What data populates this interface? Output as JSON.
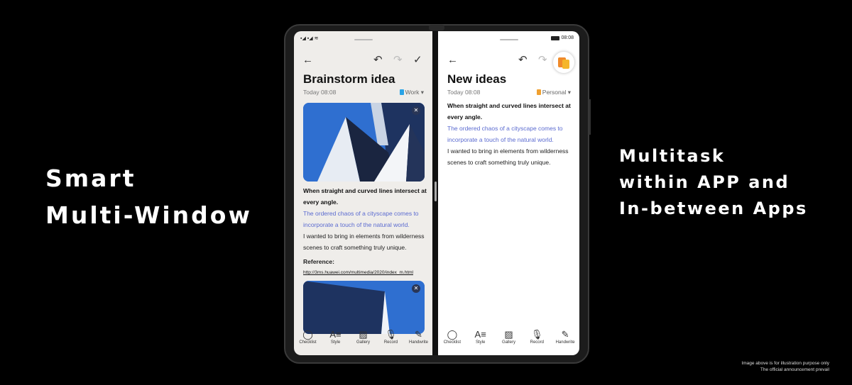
{
  "headlines": {
    "left": [
      "Smart",
      "Multi-Window"
    ],
    "right": [
      "Multitask",
      "within APP and",
      "In-between Apps"
    ]
  },
  "disclaimer": [
    "Image above is for illustration purpose only",
    "The official announcement prevail"
  ],
  "left_app": {
    "status_icons": "signal-signal-wifi",
    "title": "Brainstorm idea",
    "date": "Today 08:08",
    "category": "Work",
    "category_color": "#29a3e6",
    "paragraph_bold": "When straight and curved lines intersect at every angle.",
    "paragraph_blue": "The ordered chaos of a cityscape comes to incorporate a touch of the natural world.",
    "paragraph_normal": "I wanted to bring in elements from wilderness scenes to craft something truly unique.",
    "reference_label": "Reference:",
    "reference_link": "http://3ms.huawei.com/multimedia/2020/index_m.html",
    "toolbar": {
      "back": "←",
      "undo": "↶",
      "redo": "↷",
      "done": "✓"
    },
    "bottom_bar": [
      {
        "icon": "◯",
        "label": "Checklist"
      },
      {
        "icon": "A≡",
        "label": "Style"
      },
      {
        "icon": "▨",
        "label": "Gallery"
      },
      {
        "icon": "🎙",
        "label": "Record"
      },
      {
        "icon": "✎",
        "label": "Handwrite"
      }
    ]
  },
  "right_app": {
    "time": "08:08",
    "title": "New ideas",
    "date": "Today 08:08",
    "category": "Personal",
    "category_color": "#f0a030",
    "paragraph_bold": "When straight and curved lines intersect at every angle.",
    "paragraph_blue": "The ordered chaos of a cityscape comes to incorporate a touch of the natural world.",
    "paragraph_normal": "I wanted to bring in elements from wilderness scenes to craft something truly unique.",
    "toolbar": {
      "back": "←",
      "undo": "↶",
      "redo": "↷"
    },
    "bottom_bar": [
      {
        "icon": "◯",
        "label": "Checklist"
      },
      {
        "icon": "A≡",
        "label": "Style"
      },
      {
        "icon": "▨",
        "label": "Gallery"
      },
      {
        "icon": "🎙",
        "label": "Record"
      },
      {
        "icon": "✎",
        "label": "Handwrite"
      }
    ]
  },
  "close_glyph": "✕",
  "dropdown_glyph": "▾"
}
